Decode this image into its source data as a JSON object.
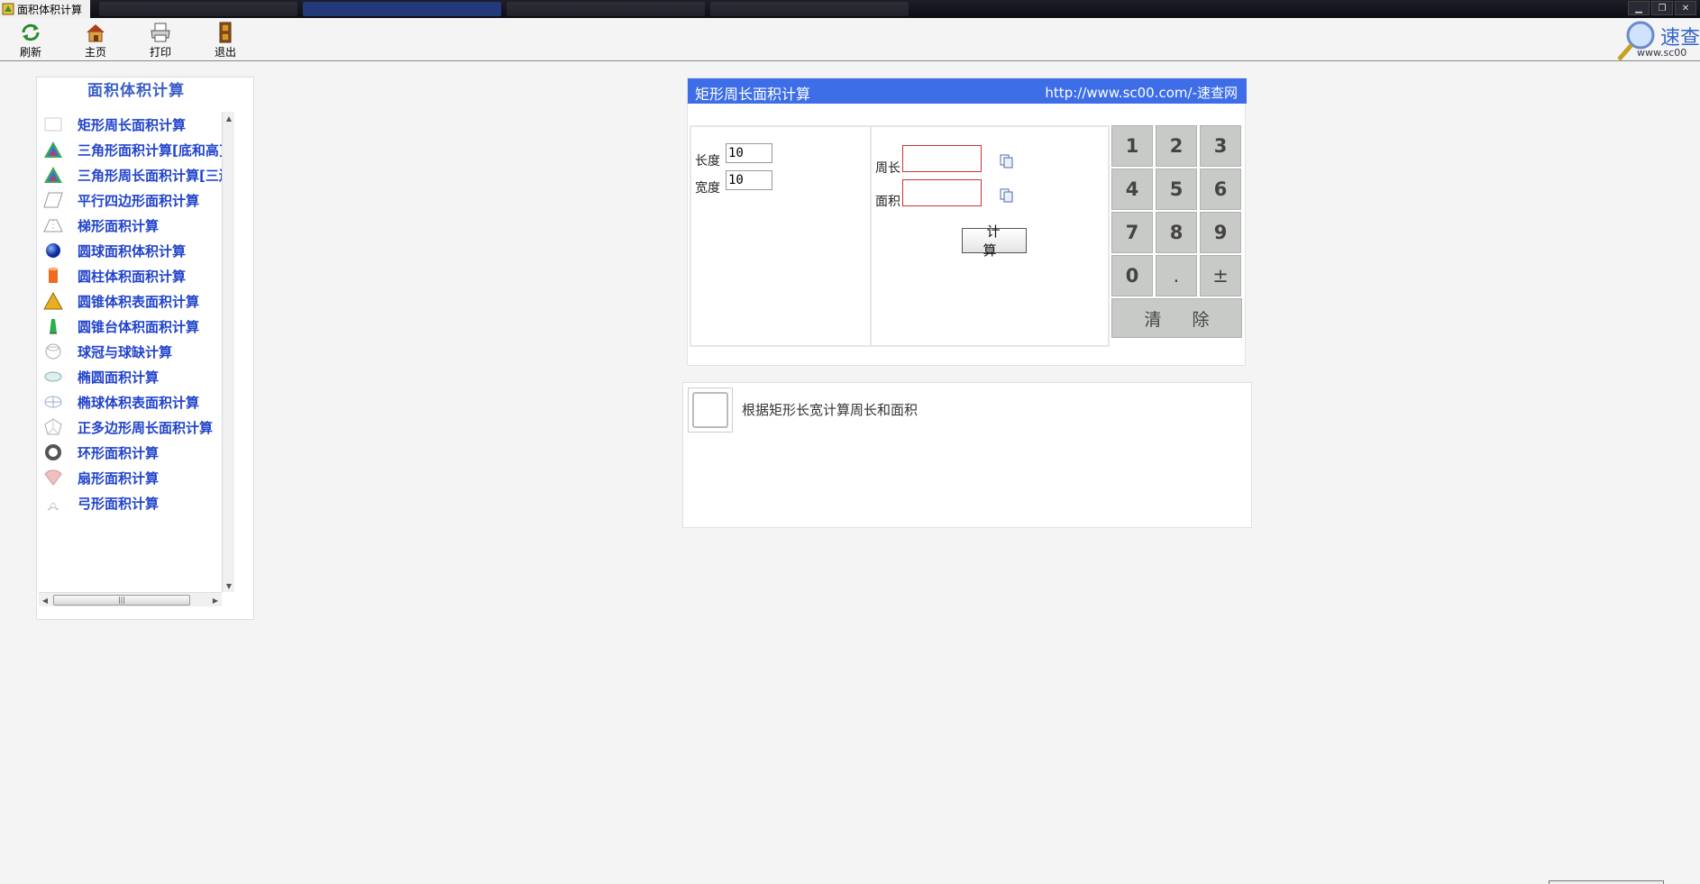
{
  "window": {
    "title": "面积体积计算"
  },
  "toolbar": {
    "items": [
      {
        "label": "刷新",
        "icon": "refresh-icon"
      },
      {
        "label": "主页",
        "icon": "home-icon"
      },
      {
        "label": "打印",
        "icon": "printer-icon"
      },
      {
        "label": "退出",
        "icon": "exit-door-icon"
      }
    ]
  },
  "brand": {
    "name": "速查",
    "url": "www.sc00"
  },
  "sidebar": {
    "title": "面积体积计算",
    "items": [
      {
        "label": "矩形周长面积计算",
        "icon": "rectangle-icon"
      },
      {
        "label": "三角形面积计算[底和高]",
        "icon": "triangle-icon"
      },
      {
        "label": "三角形周长面积计算[三边]",
        "icon": "triangle-icon"
      },
      {
        "label": "平行四边形面积计算",
        "icon": "parallelogram-icon"
      },
      {
        "label": "梯形面积计算",
        "icon": "trapezoid-icon"
      },
      {
        "label": "圆球面积体积计算",
        "icon": "sphere-icon"
      },
      {
        "label": "圆柱体积面积计算",
        "icon": "cylinder-icon"
      },
      {
        "label": "圆锥体积表面积计算",
        "icon": "cone-icon"
      },
      {
        "label": "圆锥台体积面积计算",
        "icon": "frustum-icon"
      },
      {
        "label": "球冠与球缺计算",
        "icon": "spherical-cap-icon"
      },
      {
        "label": "椭圆面积计算",
        "icon": "ellipse-icon"
      },
      {
        "label": "椭球体积表面积计算",
        "icon": "ellipsoid-icon"
      },
      {
        "label": "正多边形周长面积计算",
        "icon": "polygon-icon"
      },
      {
        "label": "环形面积计算",
        "icon": "ring-icon"
      },
      {
        "label": "扇形面积计算",
        "icon": "sector-icon"
      },
      {
        "label": "弓形面积计算",
        "icon": "segment-icon"
      }
    ]
  },
  "calculator": {
    "title": "矩形周长面积计算",
    "url": "http://www.sc00.com/-速查网",
    "inputs": {
      "length_label": "长度",
      "length_value": "10",
      "width_label": "宽度",
      "width_value": "10"
    },
    "results": {
      "perimeter_label": "周长",
      "perimeter_value": "",
      "area_label": "面积",
      "area_value": ""
    },
    "calc_button": "计 算",
    "keypad": {
      "keys": [
        "1",
        "2",
        "3",
        "4",
        "5",
        "6",
        "7",
        "8",
        "9",
        "0",
        ".",
        "±"
      ],
      "clear_label": "清 除"
    }
  },
  "description": {
    "text": "根据矩形长宽计算周长和面积",
    "icon": "rectangle-thumbnail-icon"
  },
  "colors": {
    "header_bg": "#3d6ee8",
    "link_blue": "#2244cc",
    "key_gray": "#c8cac7",
    "result_border": "#cc3333"
  }
}
